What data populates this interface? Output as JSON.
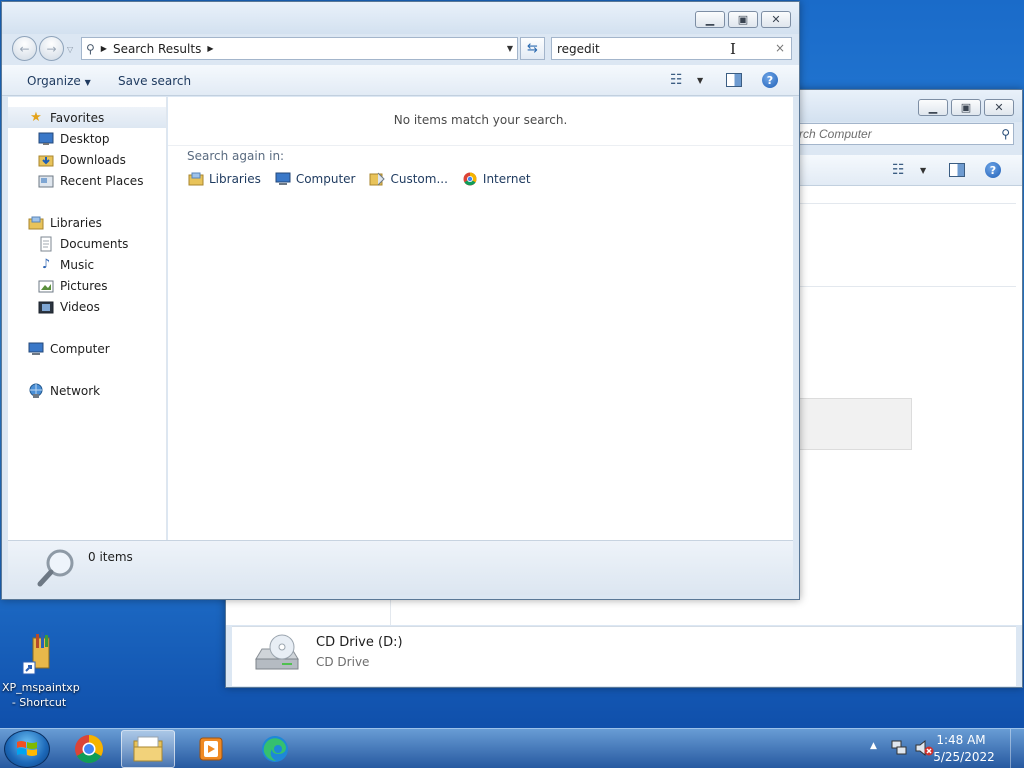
{
  "back_window": {
    "search_placeholder": "rch Computer",
    "drive": {
      "name": "CD Drive (D:)",
      "type": "CD Drive"
    }
  },
  "front_window": {
    "address": {
      "crumb": "Search Results"
    },
    "search": {
      "value": "regedit",
      "clear_glyph": "×"
    },
    "cmdbar": {
      "organize": "Organize",
      "save_search": "Save search",
      "help": "?"
    },
    "nav": {
      "favorites": "Favorites",
      "desktop": "Desktop",
      "downloads": "Downloads",
      "recent_places": "Recent Places",
      "libraries": "Libraries",
      "documents": "Documents",
      "music": "Music",
      "pictures": "Pictures",
      "videos": "Videos",
      "computer": "Computer",
      "network": "Network"
    },
    "content": {
      "no_items": "No items match your search.",
      "search_again": "Search again in:",
      "locations": [
        "Libraries",
        "Computer",
        "Custom...",
        "Internet"
      ]
    },
    "details": {
      "count": "0 items"
    }
  },
  "desktop": {
    "shortcut_line1": "XP_mspaintxp",
    "shortcut_line2": "- Shortcut"
  },
  "taskbar": {
    "time": "1:48 AM",
    "date": "5/25/2022"
  }
}
